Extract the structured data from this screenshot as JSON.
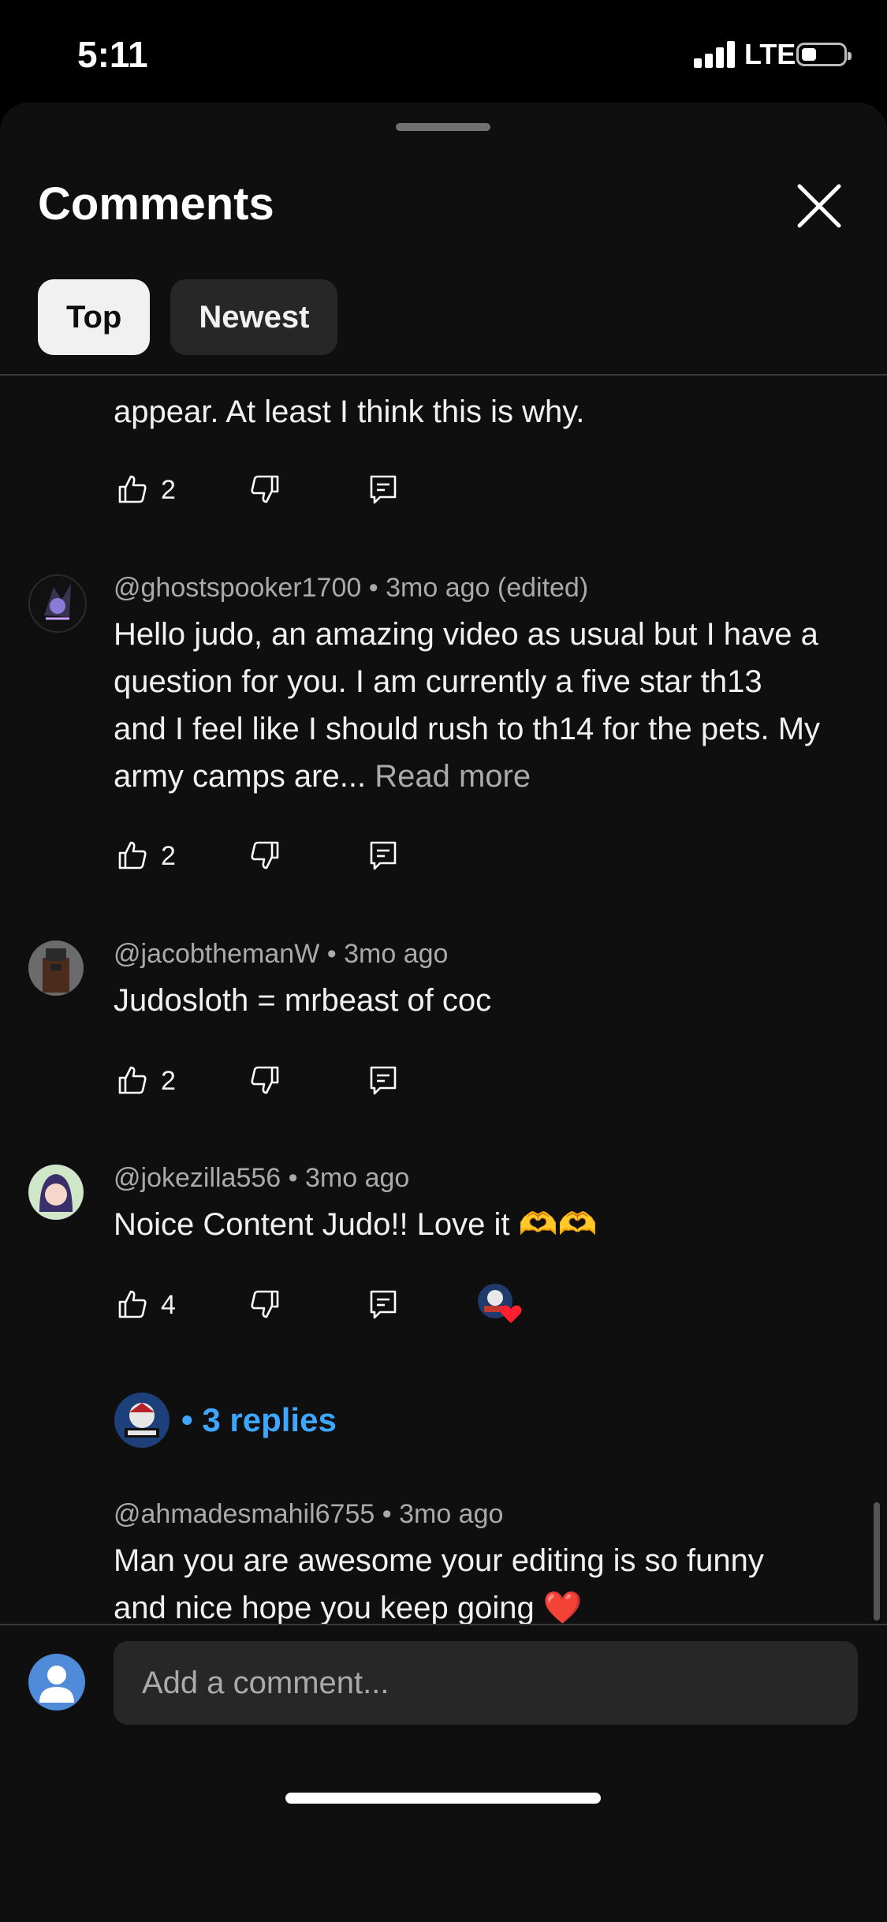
{
  "status_bar": {
    "time": "5:11",
    "network": "LTE"
  },
  "sheet": {
    "title": "Comments",
    "tabs": [
      "Top",
      "Newest"
    ]
  },
  "comments": [
    {
      "body": "appear. At least I think this is why.",
      "likes": "2"
    },
    {
      "author": "@ghostspooker1700",
      "time": "3mo ago (edited)",
      "body": "Hello judo, an amazing video as usual but I have a question for you. I am currently a five star th13 and I feel like I should rush to th14 for the pets. My army camps are...",
      "read_more": "Read more",
      "likes": "2"
    },
    {
      "author": "@jacobthemanW",
      "time": "3mo ago",
      "body": "Judosloth = mrbeast of coc",
      "likes": "2"
    },
    {
      "author": "@jokezilla556",
      "time": "3mo ago",
      "body": "Noice Content Judo!! Love it 🫶🫶",
      "likes": "4",
      "replies": "3 replies"
    },
    {
      "author": "@ahmadesmahil6755",
      "time": "3mo ago",
      "body": "Man you are awesome your editing is so funny and nice hope you keep going ❤️"
    }
  ],
  "input": {
    "placeholder": "Add a comment..."
  },
  "colors": {
    "background": "#0f0f0f",
    "link": "#3ea6ff",
    "muted": "#aaaaaa"
  }
}
